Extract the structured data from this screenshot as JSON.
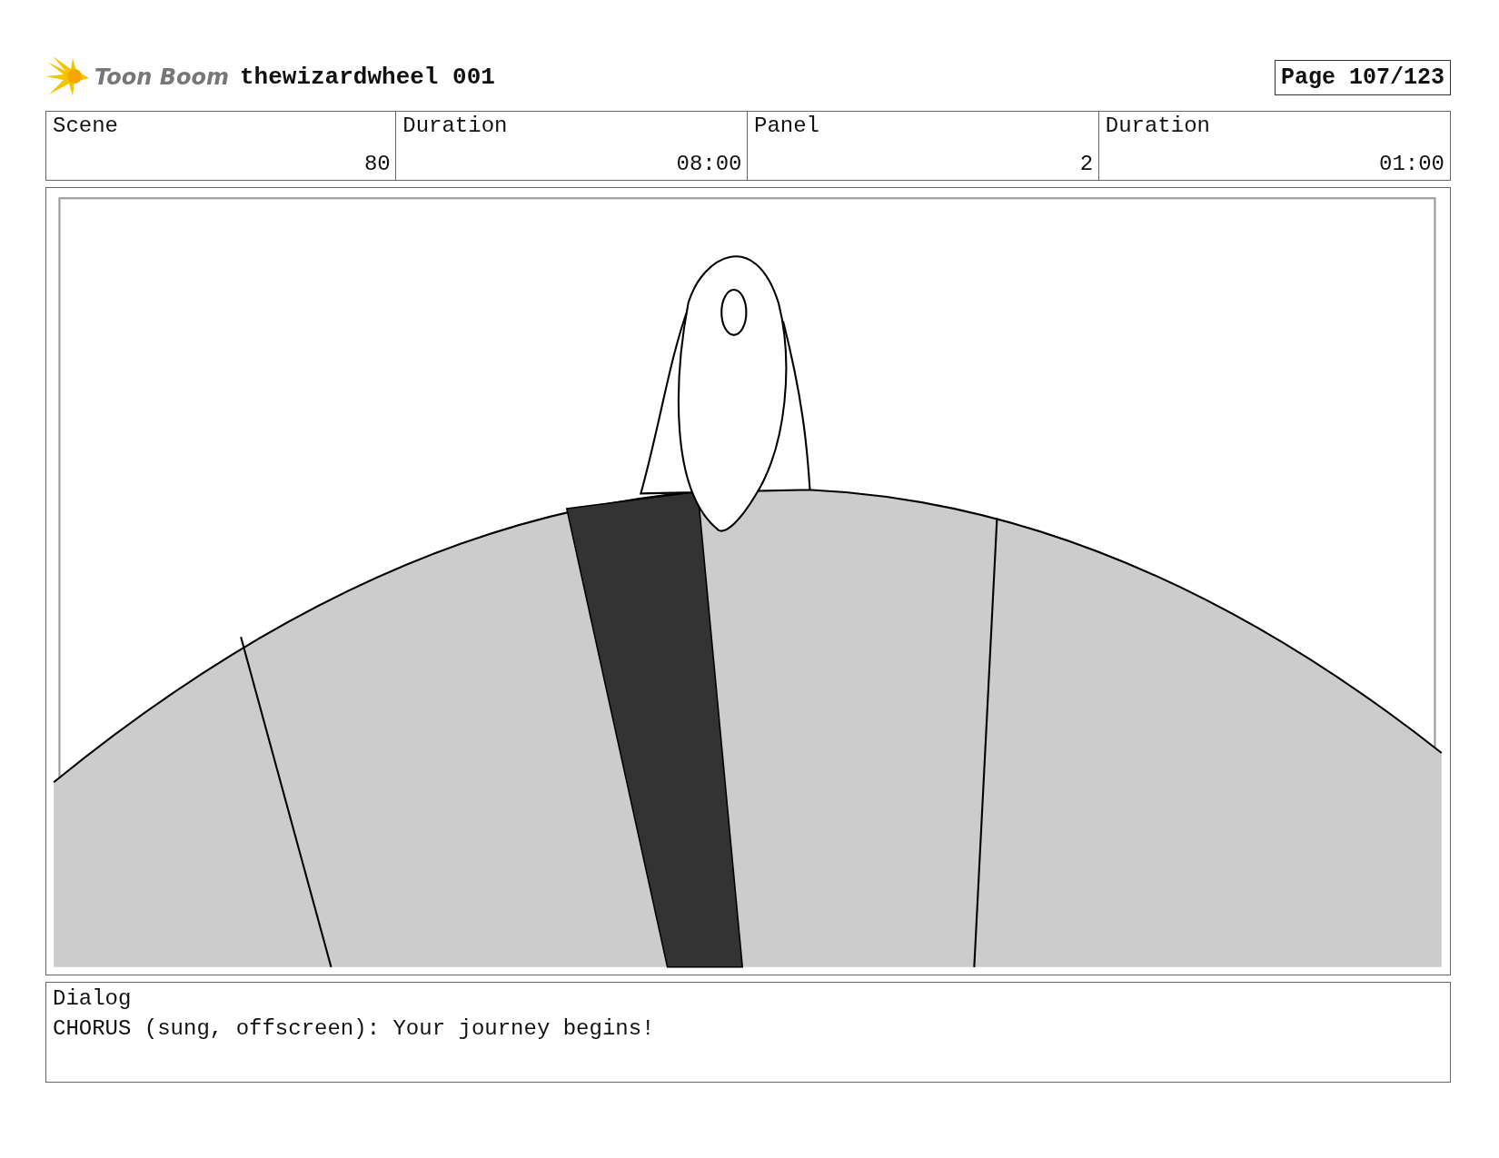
{
  "header": {
    "logo_text": "Toon Boom",
    "title": "thewizardwheel 001",
    "page": "Page 107/123"
  },
  "info_table": {
    "columns": [
      "Scene",
      "Duration",
      "Panel",
      "Duration"
    ],
    "rows": [
      [
        "80",
        "08:00",
        "2",
        "01:00"
      ]
    ]
  },
  "dialog": {
    "label": "Dialog",
    "text": "CHORUS (sung, offscreen): Your journey begins!"
  }
}
